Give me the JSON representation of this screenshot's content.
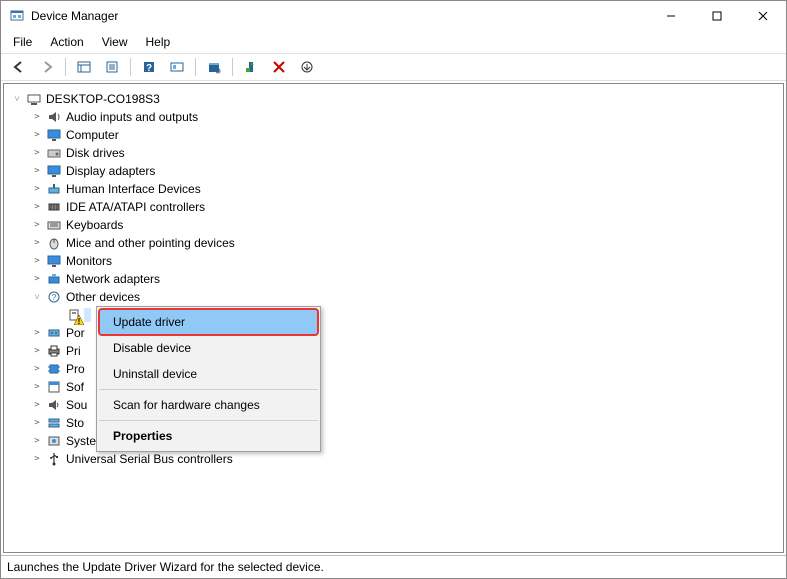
{
  "window": {
    "title": "Device Manager"
  },
  "menubar": [
    "File",
    "Action",
    "View",
    "Help"
  ],
  "root": {
    "label": "DESKTOP-CO198S3"
  },
  "categories": [
    {
      "label": "Audio inputs and outputs",
      "icon": "speaker"
    },
    {
      "label": "Computer",
      "icon": "monitor"
    },
    {
      "label": "Disk drives",
      "icon": "disk"
    },
    {
      "label": "Display adapters",
      "icon": "monitor"
    },
    {
      "label": "Human Interface Devices",
      "icon": "hid"
    },
    {
      "label": "IDE ATA/ATAPI controllers",
      "icon": "ide"
    },
    {
      "label": "Keyboards",
      "icon": "keyboard"
    },
    {
      "label": "Mice and other pointing devices",
      "icon": "mouse"
    },
    {
      "label": "Monitors",
      "icon": "monitor"
    },
    {
      "label": "Network adapters",
      "icon": "network"
    },
    {
      "label": "Other devices",
      "icon": "other",
      "expanded": true
    }
  ],
  "truncated_children": [
    {
      "label": "Por",
      "icon": "port"
    },
    {
      "label": "Pri",
      "icon": "printer"
    },
    {
      "label": "Pro",
      "icon": "processor"
    },
    {
      "label": "Sof",
      "icon": "software"
    },
    {
      "label": "Sou",
      "icon": "sound"
    },
    {
      "label": "Sto",
      "icon": "storage"
    }
  ],
  "remaining_categories": [
    {
      "label": "System devices",
      "icon": "system"
    },
    {
      "label": "Universal Serial Bus controllers",
      "icon": "usb"
    }
  ],
  "context_menu": {
    "items": [
      {
        "label": "Update driver",
        "highlight": true,
        "redbox": true
      },
      {
        "label": "Disable device"
      },
      {
        "label": "Uninstall device"
      }
    ],
    "items2": [
      {
        "label": "Scan for hardware changes"
      }
    ],
    "items3": [
      {
        "label": "Properties",
        "bold": true
      }
    ]
  },
  "statusbar": "Launches the Update Driver Wizard for the selected device."
}
